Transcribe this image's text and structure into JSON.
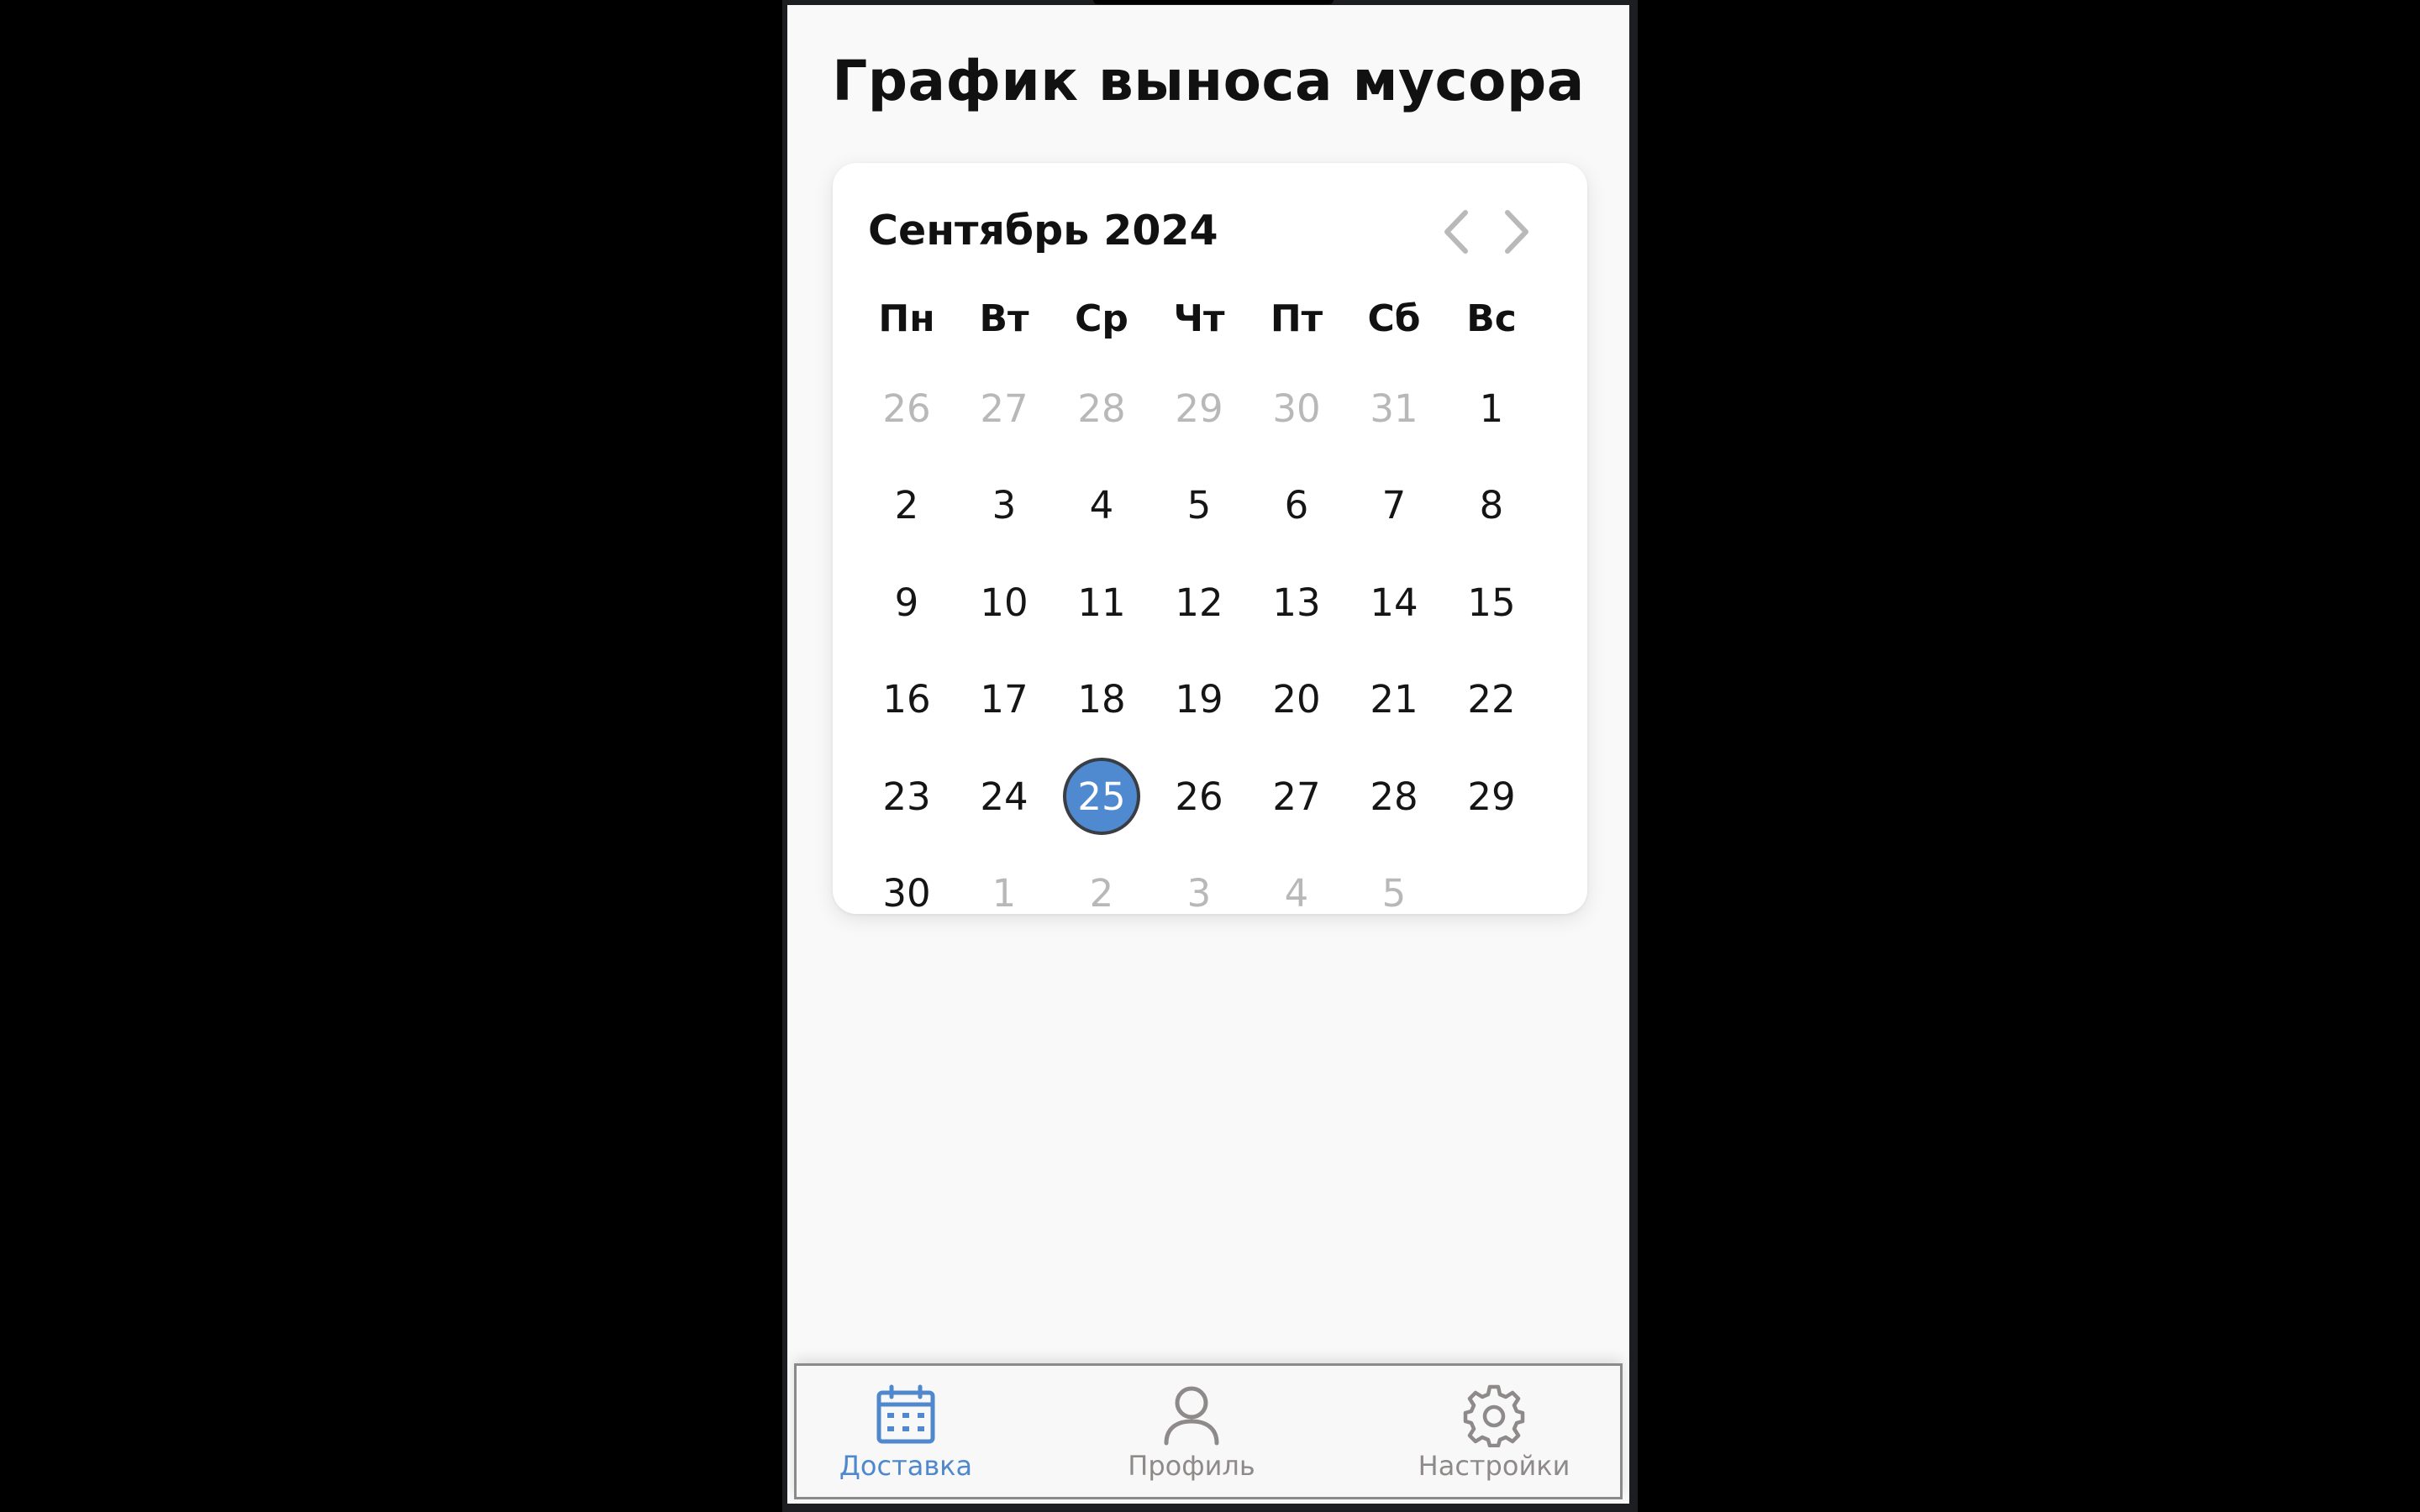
{
  "page": {
    "title": "График выноса мусора"
  },
  "calendar": {
    "month_label": "Сентябрь 2024",
    "prev_icon": "chevron-left-icon",
    "next_icon": "chevron-right-icon",
    "weekdays": [
      "Пн",
      "Вт",
      "Ср",
      "Чт",
      "Пт",
      "Сб",
      "Вс"
    ],
    "weeks": [
      [
        {
          "d": "26",
          "m": true
        },
        {
          "d": "27",
          "m": true
        },
        {
          "d": "28",
          "m": true
        },
        {
          "d": "29",
          "m": true
        },
        {
          "d": "30",
          "m": true
        },
        {
          "d": "31",
          "m": true
        },
        {
          "d": "1"
        }
      ],
      [
        {
          "d": "2"
        },
        {
          "d": "3"
        },
        {
          "d": "4"
        },
        {
          "d": "5"
        },
        {
          "d": "6"
        },
        {
          "d": "7"
        },
        {
          "d": "8"
        }
      ],
      [
        {
          "d": "9"
        },
        {
          "d": "10"
        },
        {
          "d": "11"
        },
        {
          "d": "12"
        },
        {
          "d": "13"
        },
        {
          "d": "14"
        },
        {
          "d": "15"
        }
      ],
      [
        {
          "d": "16"
        },
        {
          "d": "17"
        },
        {
          "d": "18"
        },
        {
          "d": "19"
        },
        {
          "d": "20"
        },
        {
          "d": "21"
        },
        {
          "d": "22"
        }
      ],
      [
        {
          "d": "23"
        },
        {
          "d": "24"
        },
        {
          "d": "25",
          "sel": true
        },
        {
          "d": "26"
        },
        {
          "d": "27"
        },
        {
          "d": "28"
        },
        {
          "d": "29"
        }
      ],
      [
        {
          "d": "30"
        },
        {
          "d": "1",
          "m": true
        },
        {
          "d": "2",
          "m": true
        },
        {
          "d": "3",
          "m": true
        },
        {
          "d": "4",
          "m": true
        },
        {
          "d": "5",
          "m": true
        }
      ]
    ],
    "selected_day": "25"
  },
  "tabbar": {
    "tabs": [
      {
        "label": "Доставка",
        "icon": "calendar-icon",
        "active": true
      },
      {
        "label": "Профиль",
        "icon": "user-icon",
        "active": false
      },
      {
        "label": "Настройки",
        "icon": "gear-icon",
        "active": false
      }
    ]
  },
  "colors": {
    "accent": "#4f8ad0",
    "muted_text": "#b8b8b8",
    "tab_inactive": "#8f8a8a",
    "background": "#f9f9f9"
  }
}
